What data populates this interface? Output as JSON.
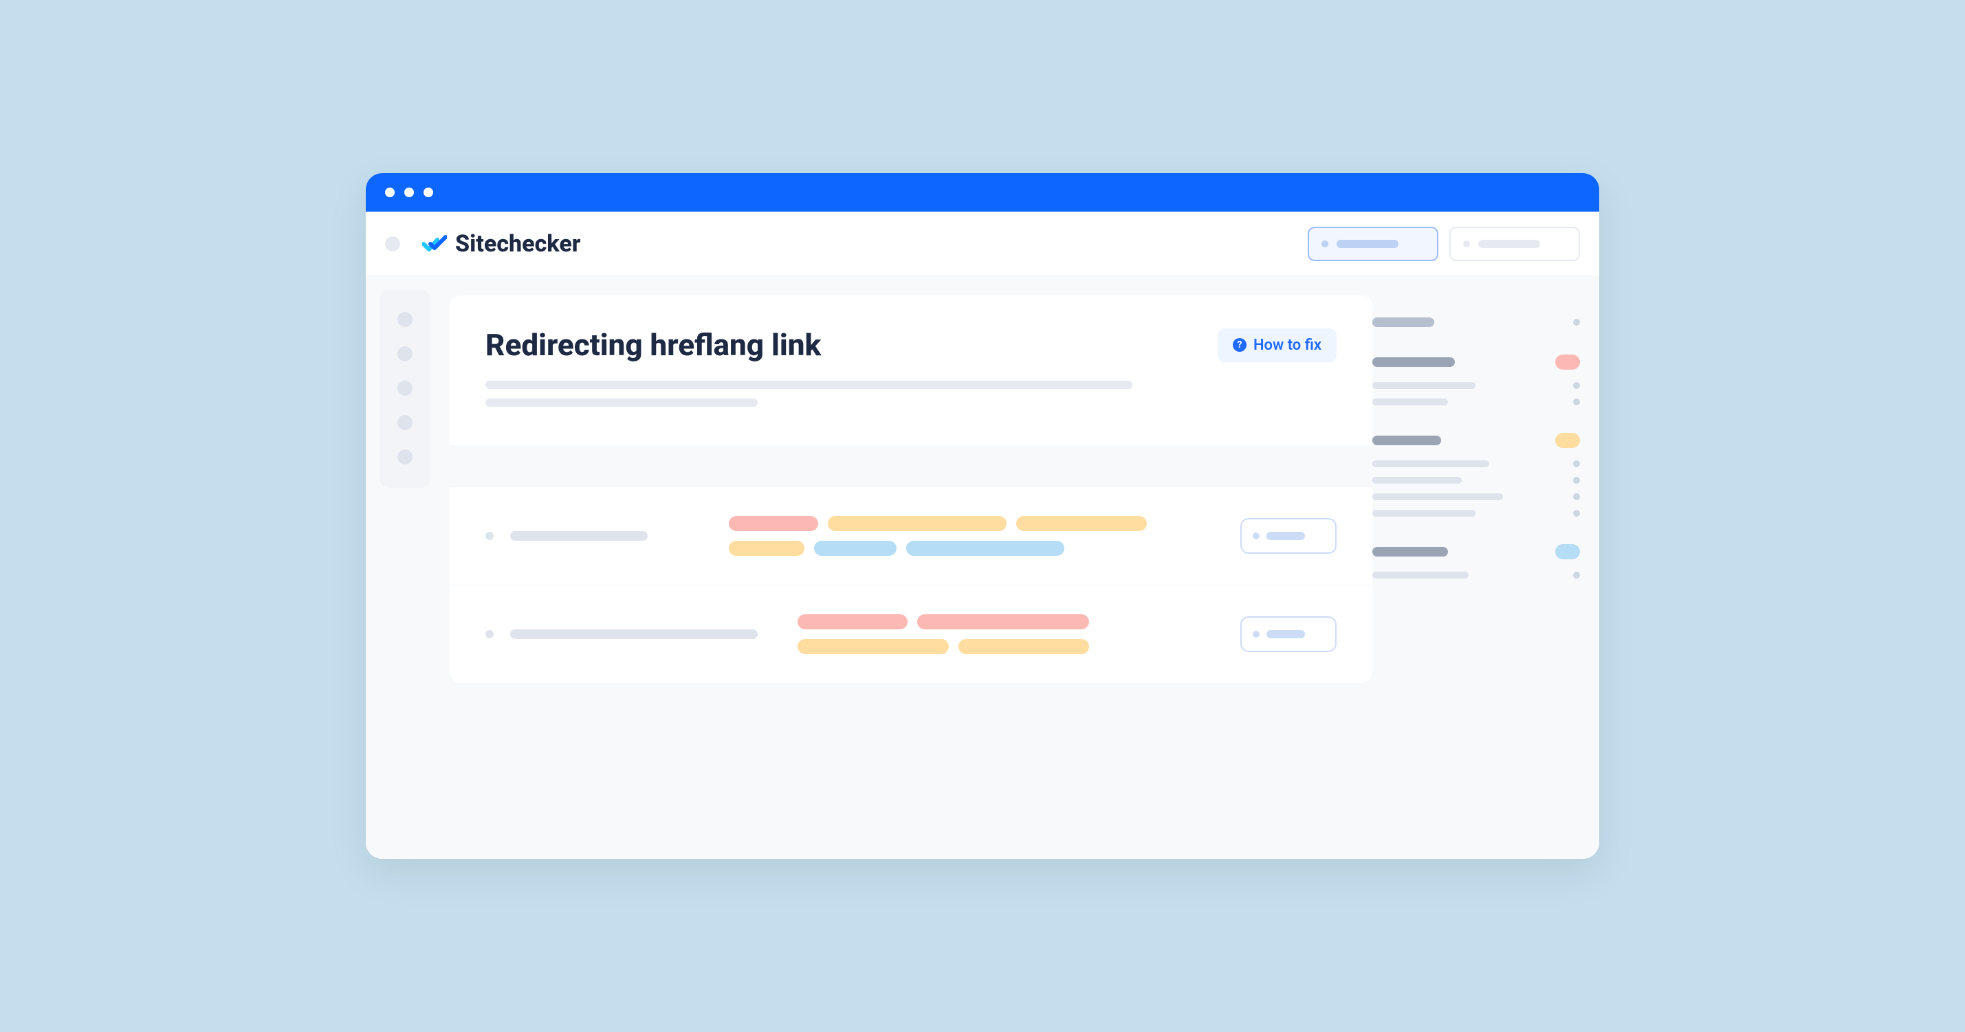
{
  "app_name": "Sitechecker",
  "page_title": "Redirecting hreflang link",
  "how_to_fix_label": "How to fix",
  "colors": {
    "brand_blue": "#0d66ff",
    "pill_red": "#fcb9b3",
    "pill_yellow": "#ffdca0",
    "pill_blue": "#b5ddf5",
    "text_dark": "#1e2a43"
  }
}
